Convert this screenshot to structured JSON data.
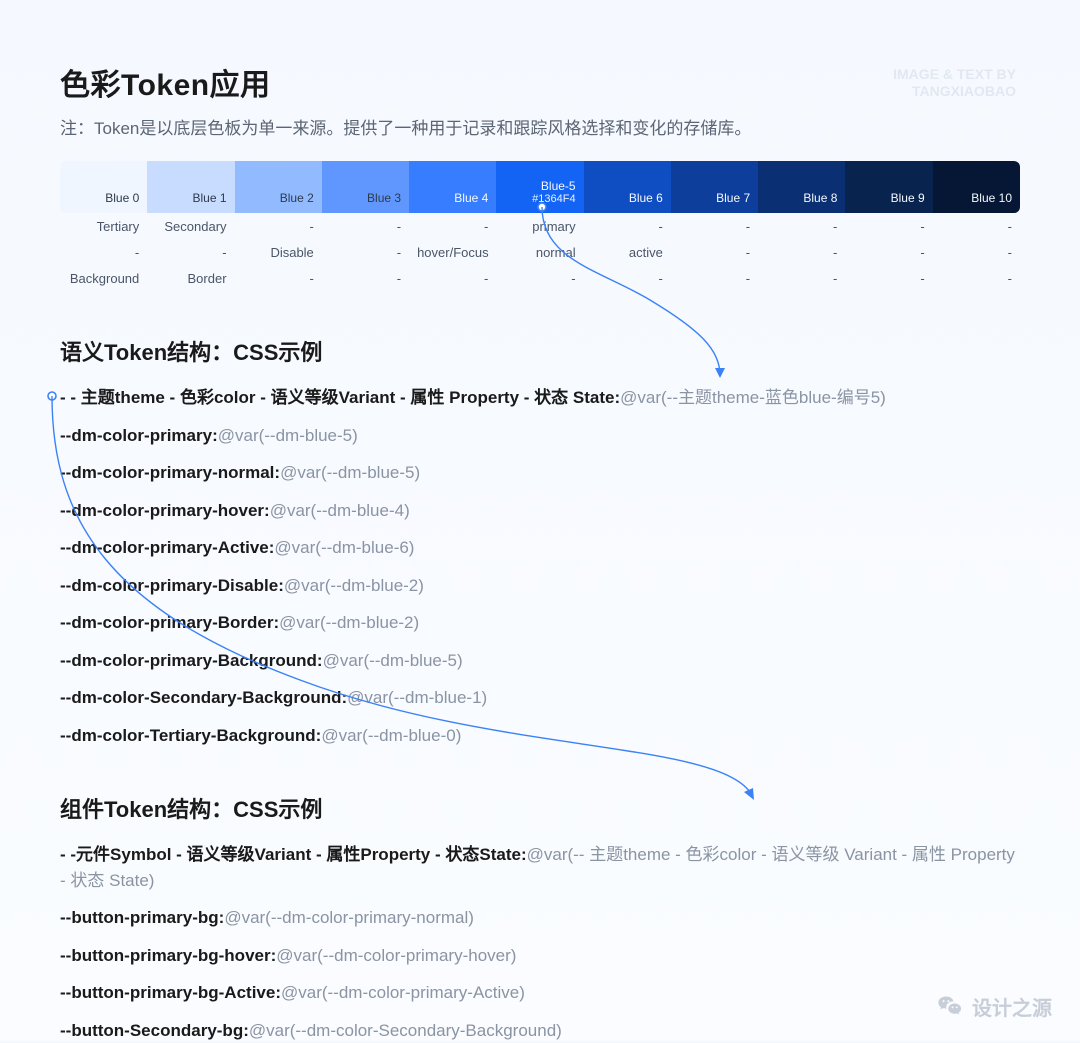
{
  "header": {
    "title": "色彩Token应用",
    "watermark_line1": "IMAGE & TEXT BY",
    "watermark_line2": "TANGXIAOBAO",
    "subtitle": "注：Token是以底层色板为单一来源。提供了一种用于记录和跟踪风格选择和变化的存储库。"
  },
  "palette": {
    "swatches": [
      {
        "label": "Blue 0",
        "hex": "",
        "color": "#f0f6ff",
        "dark": false
      },
      {
        "label": "Blue 1",
        "hex": "",
        "color": "#c7dcff",
        "dark": false
      },
      {
        "label": "Blue 2",
        "hex": "",
        "color": "#92baff",
        "dark": false
      },
      {
        "label": "Blue 3",
        "hex": "",
        "color": "#5f97ff",
        "dark": false
      },
      {
        "label": "Blue 4",
        "hex": "",
        "color": "#377dff",
        "dark": true
      },
      {
        "label": "Blue-5",
        "hex": "#1364F4",
        "color": "#1364f4",
        "dark": true
      },
      {
        "label": "Blue 6",
        "hex": "",
        "color": "#0f4ec2",
        "dark": true
      },
      {
        "label": "Blue 7",
        "hex": "",
        "color": "#0d3e9b",
        "dark": true
      },
      {
        "label": "Blue 8",
        "hex": "",
        "color": "#0b2f73",
        "dark": true
      },
      {
        "label": "Blue 9",
        "hex": "",
        "color": "#09234f",
        "dark": true
      },
      {
        "label": "Blue 10",
        "hex": "",
        "color": "#061735",
        "dark": true
      }
    ],
    "rows": [
      [
        "Tertiary",
        "Secondary",
        "-",
        "-",
        "-",
        "primary",
        "-",
        "-",
        "-",
        "-",
        "-"
      ],
      [
        "-",
        "-",
        "Disable",
        "-",
        "hover/Focus",
        "normal",
        "active",
        "-",
        "-",
        "-",
        "-"
      ],
      [
        "Background",
        "Border",
        "-",
        "-",
        "-",
        "-",
        "-",
        "-",
        "-",
        "-",
        "-"
      ]
    ]
  },
  "semantic": {
    "title": "语义Token结构：CSS示例",
    "pattern": {
      "head": "- - 主题theme - 色彩color  - 语义等级Variant - 属性 Property  - 状态 State:",
      "val": "@var(--主题theme-蓝色blue-编号5)"
    },
    "lines": [
      {
        "head": "--dm-color-primary:",
        "val": "@var(--dm-blue-5)"
      },
      {
        "head": "--dm-color-primary-normal:",
        "val": "@var(--dm-blue-5)"
      },
      {
        "head": "--dm-color-primary-hover:",
        "val": "@var(--dm-blue-4)"
      },
      {
        "head": "--dm-color-primary-Active:",
        "val": "@var(--dm-blue-6)"
      },
      {
        "head": "--dm-color-primary-Disable:",
        "val": "@var(--dm-blue-2)"
      },
      {
        "head": "--dm-color-primary-Border:",
        "val": "@var(--dm-blue-2)"
      },
      {
        "head": "--dm-color-primary-Background:",
        "val": "@var(--dm-blue-5)"
      },
      {
        "head": "--dm-color-Secondary-Background:",
        "val": "@var(--dm-blue-1)"
      },
      {
        "head": "--dm-color-Tertiary-Background:",
        "val": "@var(--dm-blue-0)"
      }
    ]
  },
  "component": {
    "title": "组件Token结构：CSS示例",
    "pattern": {
      "head": "- -元件Symbol - 语义等级Variant - 属性Property  - 状态State:",
      "val": "@var(-- 主题theme - 色彩color - 语义等级 Variant - 属性 Property  - 状态 State)"
    },
    "lines": [
      {
        "head": "--button-primary-bg:",
        "val": "@var(--dm-color-primary-normal)"
      },
      {
        "head": "--button-primary-bg-hover:",
        "val": "@var(--dm-color-primary-hover)"
      },
      {
        "head": "--button-primary-bg-Active:",
        "val": "@var(--dm-color-primary-Active)"
      },
      {
        "head": "--button-Secondary-bg:",
        "val": "@var(--dm-color-Secondary-Background)"
      }
    ]
  },
  "footer": {
    "watermark": "设计之源"
  }
}
